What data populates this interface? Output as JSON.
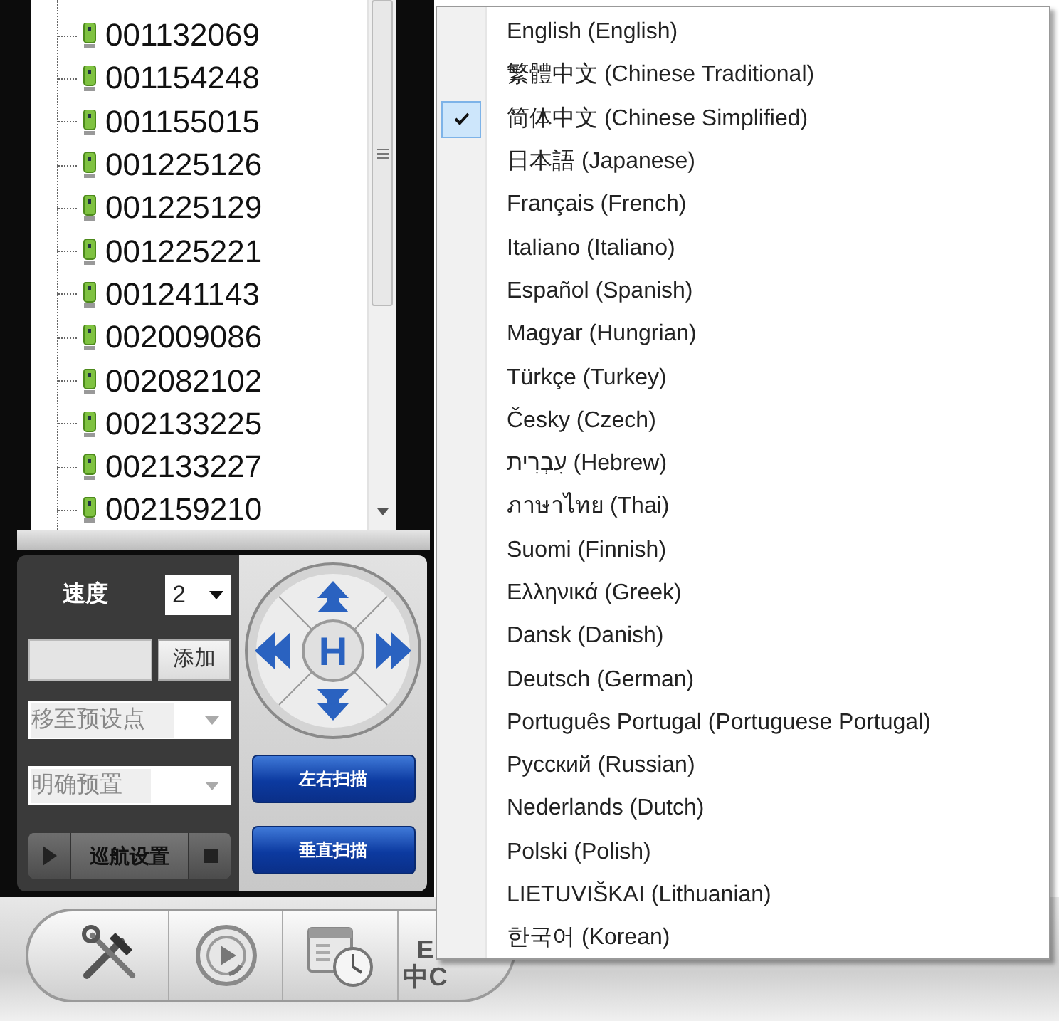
{
  "device_tree": {
    "items": [
      {
        "label": "001132069"
      },
      {
        "label": "001154248"
      },
      {
        "label": "001155015"
      },
      {
        "label": "001225126"
      },
      {
        "label": "001225129"
      },
      {
        "label": "001225221"
      },
      {
        "label": "001241143"
      },
      {
        "label": "002009086"
      },
      {
        "label": "002082102"
      },
      {
        "label": "002133225"
      },
      {
        "label": "002133227"
      },
      {
        "label": "002159210"
      }
    ]
  },
  "ptz_panel": {
    "speed_label": "速度",
    "speed_value": "2",
    "add_button": "添加",
    "goto_preset_select": {
      "placeholder": "移至预设点"
    },
    "clear_preset_select": {
      "placeholder": "明确预置"
    },
    "cruise_label": "巡航设置",
    "home_button": "H",
    "scan_buttons": [
      "左右扫描",
      "垂直扫描"
    ]
  },
  "toolbar": {
    "buttons": [
      {
        "kind": "tools"
      },
      {
        "kind": "replay"
      },
      {
        "kind": "schedule"
      },
      {
        "kind": "language",
        "label_top": "E",
        "label_bottom": "中C"
      }
    ]
  },
  "language_menu": {
    "items": [
      {
        "label": "English (English)",
        "checked": false
      },
      {
        "label": "繁體中文 (Chinese Traditional)",
        "checked": false
      },
      {
        "label": "简体中文 (Chinese Simplified)",
        "checked": true
      },
      {
        "label": "日本語 (Japanese)",
        "checked": false
      },
      {
        "label": "Français (French)",
        "checked": false
      },
      {
        "label": "Italiano (Italiano)",
        "checked": false
      },
      {
        "label": "Español (Spanish)",
        "checked": false
      },
      {
        "label": "Magyar (Hungrian)",
        "checked": false
      },
      {
        "label": "Türkçe (Turkey)",
        "checked": false
      },
      {
        "label": "Česky (Czech)",
        "checked": false
      },
      {
        "label": "עִבְרִית (Hebrew)",
        "checked": false
      },
      {
        "label": "ภาษาไทย (Thai)",
        "checked": false
      },
      {
        "label": "Suomi (Finnish)",
        "checked": false
      },
      {
        "label": "Ελληνικά (Greek)",
        "checked": false
      },
      {
        "label": "Dansk (Danish)",
        "checked": false
      },
      {
        "label": "Deutsch (German)",
        "checked": false
      },
      {
        "label": "Português Portugal (Portuguese Portugal)",
        "checked": false
      },
      {
        "label": "Русский (Russian)",
        "checked": false
      },
      {
        "label": "Nederlands (Dutch)",
        "checked": false
      },
      {
        "label": "Polski (Polish)",
        "checked": false
      },
      {
        "label": "LIETUVIŠKAI (Lithuanian)",
        "checked": false
      },
      {
        "label": "한국어 (Korean)",
        "checked": false
      }
    ]
  }
}
